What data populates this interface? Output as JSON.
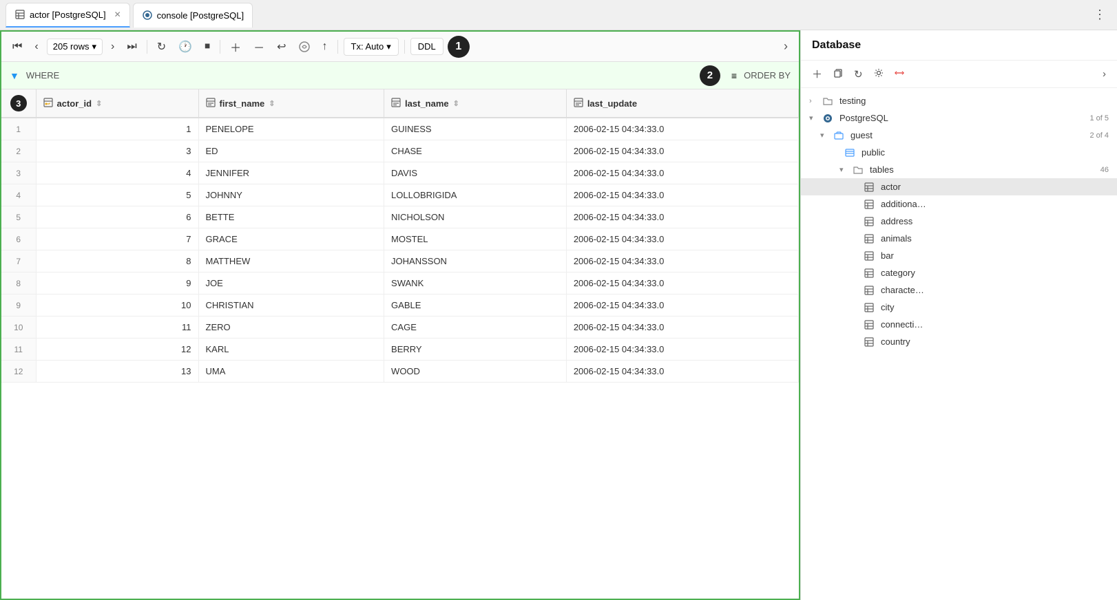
{
  "tabs": [
    {
      "id": "actor",
      "label": "actor [PostgreSQL]",
      "type": "table",
      "active": true,
      "closeable": true
    },
    {
      "id": "console",
      "label": "console [PostgreSQL]",
      "type": "console",
      "active": false,
      "closeable": false
    }
  ],
  "toolbar": {
    "rows_count": "205 rows",
    "tx_label": "Tx: Auto",
    "ddl_label": "DDL",
    "badge1": "1",
    "badge2": "2",
    "badge3": "3"
  },
  "filter": {
    "where_label": "WHERE",
    "order_by_label": "ORDER BY"
  },
  "table": {
    "columns": [
      {
        "id": "actor_id",
        "label": "actor_id",
        "icon": "key-icon"
      },
      {
        "id": "first_name",
        "label": "first_name",
        "icon": "col-icon"
      },
      {
        "id": "last_name",
        "label": "last_name",
        "icon": "col-icon"
      },
      {
        "id": "last_update",
        "label": "last_update",
        "icon": "col-icon"
      }
    ],
    "rows": [
      {
        "row": 1,
        "actor_id": 1,
        "first_name": "PENELOPE",
        "last_name": "GUINESS",
        "last_update": "2006-02-15 04:34:33.0"
      },
      {
        "row": 2,
        "actor_id": 3,
        "first_name": "ED",
        "last_name": "CHASE",
        "last_update": "2006-02-15 04:34:33.0"
      },
      {
        "row": 3,
        "actor_id": 4,
        "first_name": "JENNIFER",
        "last_name": "DAVIS",
        "last_update": "2006-02-15 04:34:33.0"
      },
      {
        "row": 4,
        "actor_id": 5,
        "first_name": "JOHNNY",
        "last_name": "LOLLOBRIGIDA",
        "last_update": "2006-02-15 04:34:33.0"
      },
      {
        "row": 5,
        "actor_id": 6,
        "first_name": "BETTE",
        "last_name": "NICHOLSON",
        "last_update": "2006-02-15 04:34:33.0"
      },
      {
        "row": 6,
        "actor_id": 7,
        "first_name": "GRACE",
        "last_name": "MOSTEL",
        "last_update": "2006-02-15 04:34:33.0"
      },
      {
        "row": 7,
        "actor_id": 8,
        "first_name": "MATTHEW",
        "last_name": "JOHANSSON",
        "last_update": "2006-02-15 04:34:33.0"
      },
      {
        "row": 8,
        "actor_id": 9,
        "first_name": "JOE",
        "last_name": "SWANK",
        "last_update": "2006-02-15 04:34:33.0"
      },
      {
        "row": 9,
        "actor_id": 10,
        "first_name": "CHRISTIAN",
        "last_name": "GABLE",
        "last_update": "2006-02-15 04:34:33.0"
      },
      {
        "row": 10,
        "actor_id": 11,
        "first_name": "ZERO",
        "last_name": "CAGE",
        "last_update": "2006-02-15 04:34:33.0"
      },
      {
        "row": 11,
        "actor_id": 12,
        "first_name": "KARL",
        "last_name": "BERRY",
        "last_update": "2006-02-15 04:34:33.0"
      },
      {
        "row": 12,
        "actor_id": 13,
        "first_name": "UMA",
        "last_name": "WOOD",
        "last_update": "2006-02-15 04:34:33.0"
      }
    ]
  },
  "sidebar": {
    "title": "Database",
    "tree": [
      {
        "level": 0,
        "label": "testing",
        "type": "folder",
        "expanded": false,
        "badge": ""
      },
      {
        "level": 0,
        "label": "PostgreSQL",
        "type": "postgres",
        "expanded": true,
        "badge": "1 of 5"
      },
      {
        "level": 1,
        "label": "guest",
        "type": "schema",
        "expanded": true,
        "badge": "2 of 4"
      },
      {
        "level": 2,
        "label": "public",
        "type": "schema2",
        "expanded": true,
        "badge": ""
      },
      {
        "level": 3,
        "label": "tables",
        "type": "folder",
        "expanded": true,
        "badge": "46"
      },
      {
        "level": 4,
        "label": "actor",
        "type": "table",
        "expanded": false,
        "badge": "",
        "active": true
      },
      {
        "level": 4,
        "label": "additiona…",
        "type": "table",
        "expanded": false,
        "badge": ""
      },
      {
        "level": 4,
        "label": "address",
        "type": "table",
        "expanded": false,
        "badge": ""
      },
      {
        "level": 4,
        "label": "animals",
        "type": "table",
        "expanded": false,
        "badge": ""
      },
      {
        "level": 4,
        "label": "bar",
        "type": "table",
        "expanded": false,
        "badge": ""
      },
      {
        "level": 4,
        "label": "category",
        "type": "table",
        "expanded": false,
        "badge": ""
      },
      {
        "level": 4,
        "label": "characte…",
        "type": "table",
        "expanded": false,
        "badge": ""
      },
      {
        "level": 4,
        "label": "city",
        "type": "table",
        "expanded": false,
        "badge": ""
      },
      {
        "level": 4,
        "label": "connecti…",
        "type": "table",
        "expanded": false,
        "badge": ""
      },
      {
        "level": 4,
        "label": "country",
        "type": "table",
        "expanded": false,
        "badge": ""
      }
    ]
  }
}
